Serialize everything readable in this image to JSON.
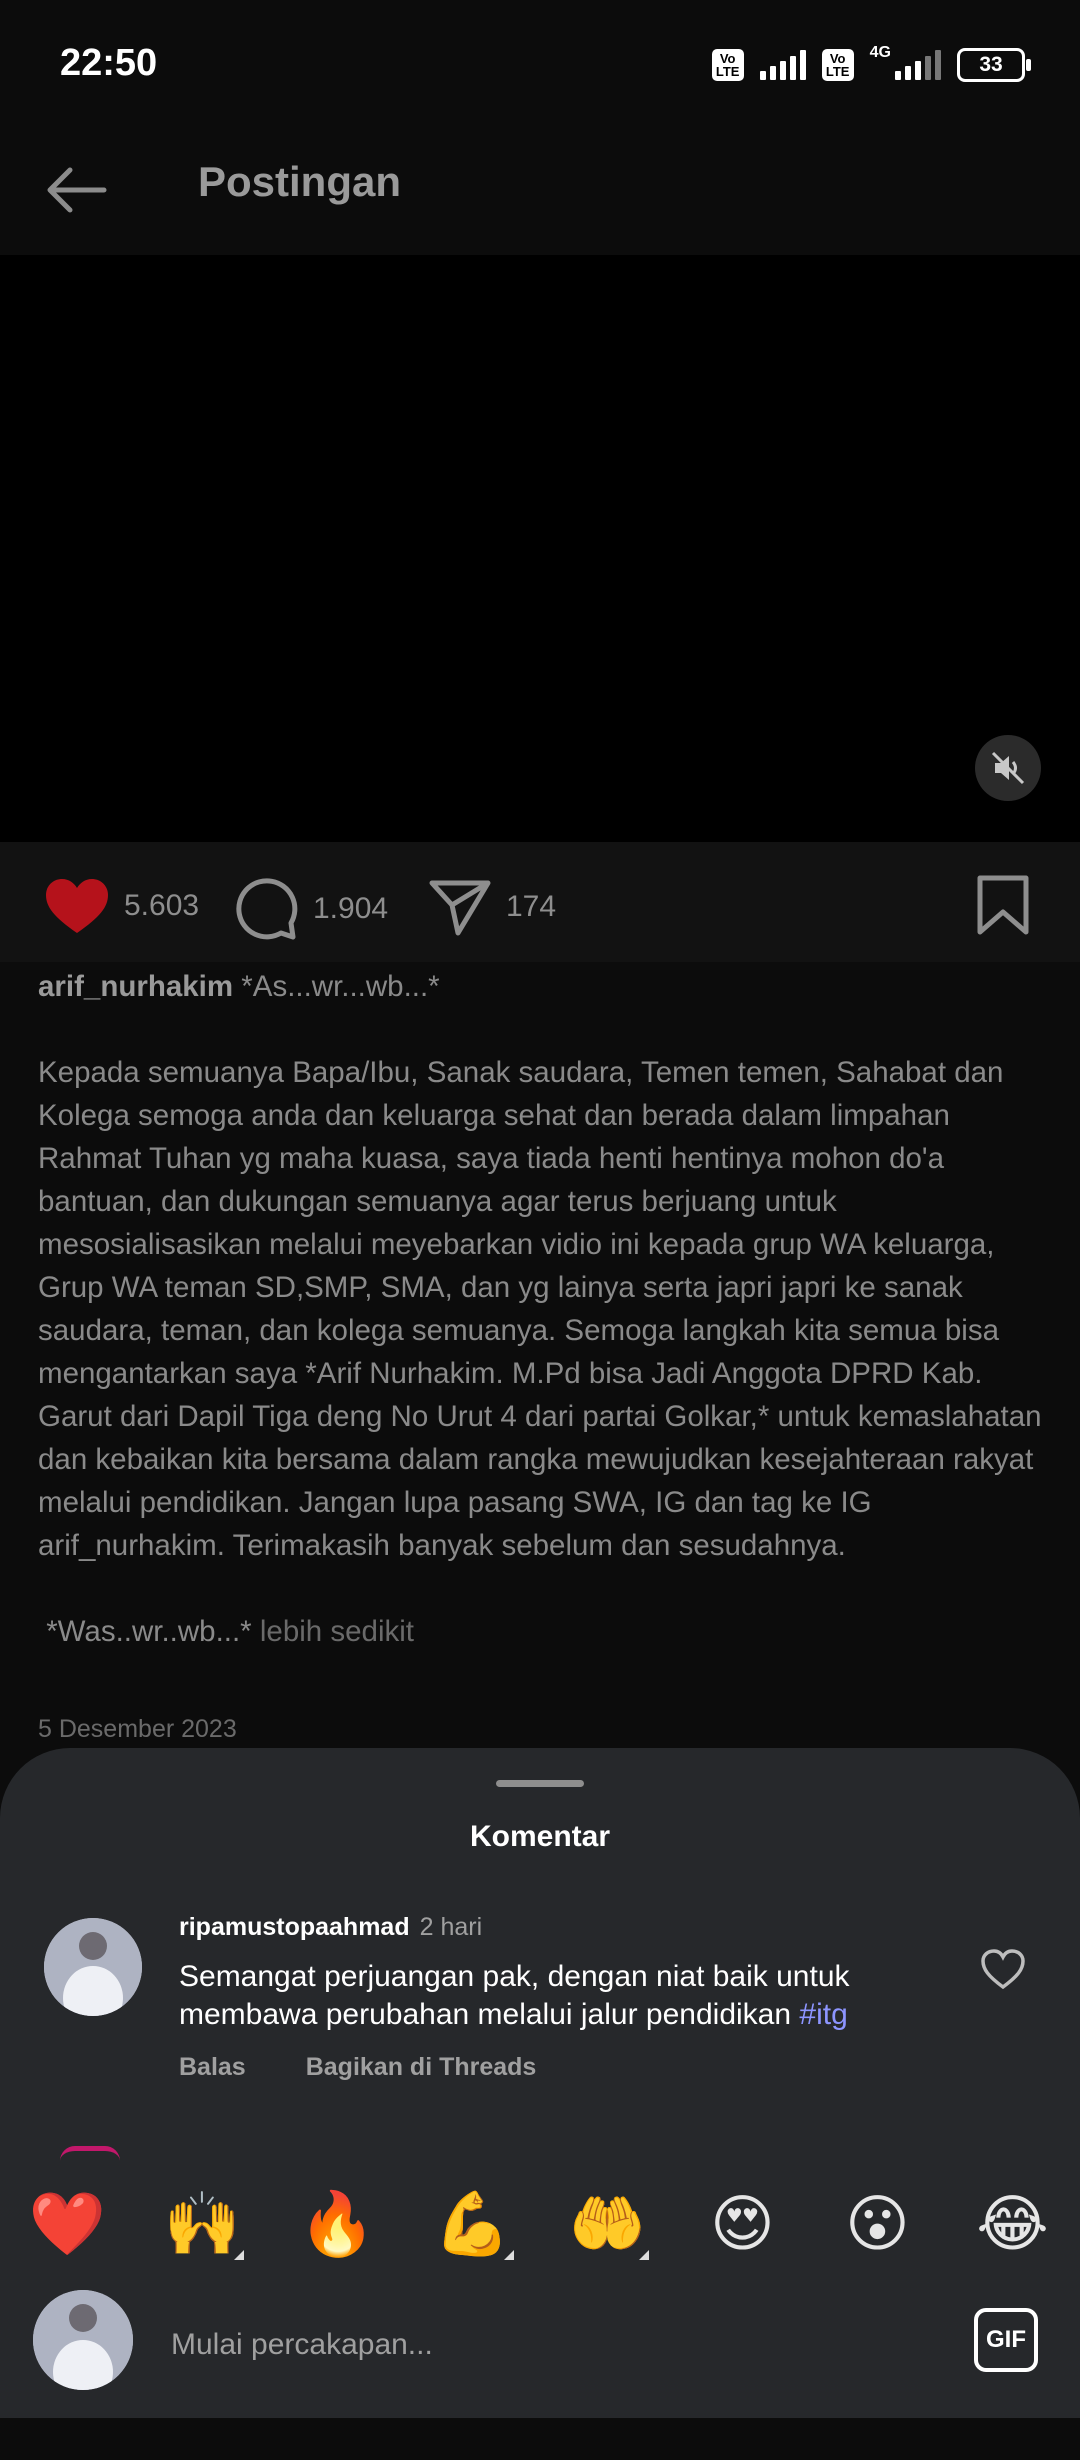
{
  "status": {
    "time": "22:50",
    "volte": "Vo LTE",
    "network": "4G",
    "battery": "33"
  },
  "header": {
    "title": "Postingan"
  },
  "actions": {
    "likes": "5.603",
    "comments": "1.904",
    "shares": "174"
  },
  "caption": {
    "username": "arif_nurhakim",
    "greeting": "*As...wr...wb...*",
    "body": "Kepada semuanya Bapa/Ibu, Sanak saudara, Temen temen, Sahabat dan Kolega semoga anda dan keluarga sehat dan berada dalam limpahan Rahmat Tuhan yg maha kuasa, saya tiada henti hentinya mohon do'a bantuan, dan dukungan semuanya agar terus berjuang untuk mesosialisasikan melalui meyebarkan vidio ini kepada grup WA keluarga, Grup WA teman SD,SMP, SMA, dan yg lainya serta japri japri ke sanak saudara, teman, dan kolega semuanya. Semoga langkah kita semua bisa mengantarkan saya *Arif Nurhakim. M.Pd bisa Jadi Anggota DPRD Kab. Garut dari Dapil Tiga deng No Urut 4 dari partai Golkar,* untuk kemaslahatan dan kebaikan kita bersama dalam rangka mewujudkan kesejahteraan rakyat melalui pendidikan. Jangan lupa pasang SWA, IG dan tag ke IG arif_nurhakim. Terimakasih banyak sebelum dan sesudahnya.",
    "closing": "*Was..wr..wb...*",
    "less_label": "lebih sedikit",
    "date": "5 Desember 2023"
  },
  "comments_sheet": {
    "title": "Komentar",
    "comments": [
      {
        "username": "ripamustopaahmad",
        "time": "2 hari",
        "text": "Semangat perjuangan pak, dengan niat baik untuk membawa perubahan melalui jalur pendidikan",
        "hashtag": "#itg",
        "reply_label": "Balas",
        "share_label": "Bagikan di Threads"
      }
    ],
    "emojis": [
      "❤️",
      "🙌",
      "🔥",
      "💪",
      "🤲",
      "😍",
      "😮",
      "😂"
    ],
    "input_placeholder": "Mulai percakapan...",
    "gif_label": "GIF"
  },
  "colors": {
    "like": "#b5121b",
    "hashtag": "#8d95ff",
    "sheet_bg": "#26282b"
  }
}
